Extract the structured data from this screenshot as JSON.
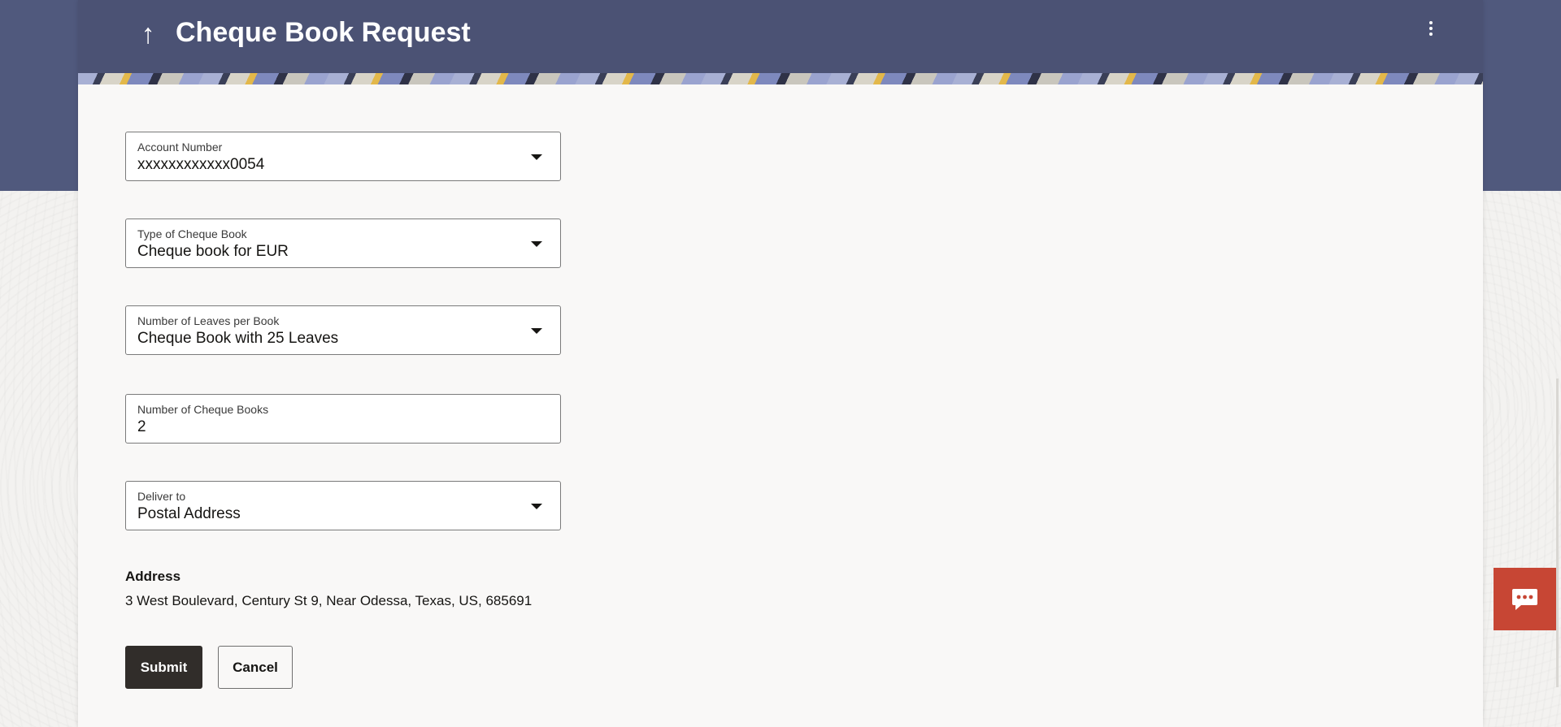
{
  "header": {
    "title": "Cheque Book Request",
    "back_icon": "arrow-up-icon",
    "menu_icon": "kebab-menu-icon"
  },
  "form": {
    "account_number": {
      "label": "Account Number",
      "value": "xxxxxxxxxxxx0054"
    },
    "cheque_book_type": {
      "label": "Type of Cheque Book",
      "value": "Cheque book for EUR"
    },
    "leaves_per_book": {
      "label": "Number of Leaves per Book",
      "value": "Cheque Book with 25 Leaves"
    },
    "cheque_book_count": {
      "label": "Number of Cheque Books",
      "value": "2"
    },
    "deliver_to": {
      "label": "Deliver to",
      "value": "Postal Address"
    },
    "address": {
      "label": "Address",
      "value": "3 West Boulevard, Century St 9, Near Odessa, Texas, US, 685691"
    }
  },
  "actions": {
    "submit_label": "Submit",
    "cancel_label": "Cancel"
  },
  "chat": {
    "icon": "chat-bubble-icon"
  },
  "colors": {
    "header_bg": "#4b5274",
    "band_bg": "#50597d",
    "primary_button": "#312d2a",
    "chat_button": "#c74634"
  }
}
